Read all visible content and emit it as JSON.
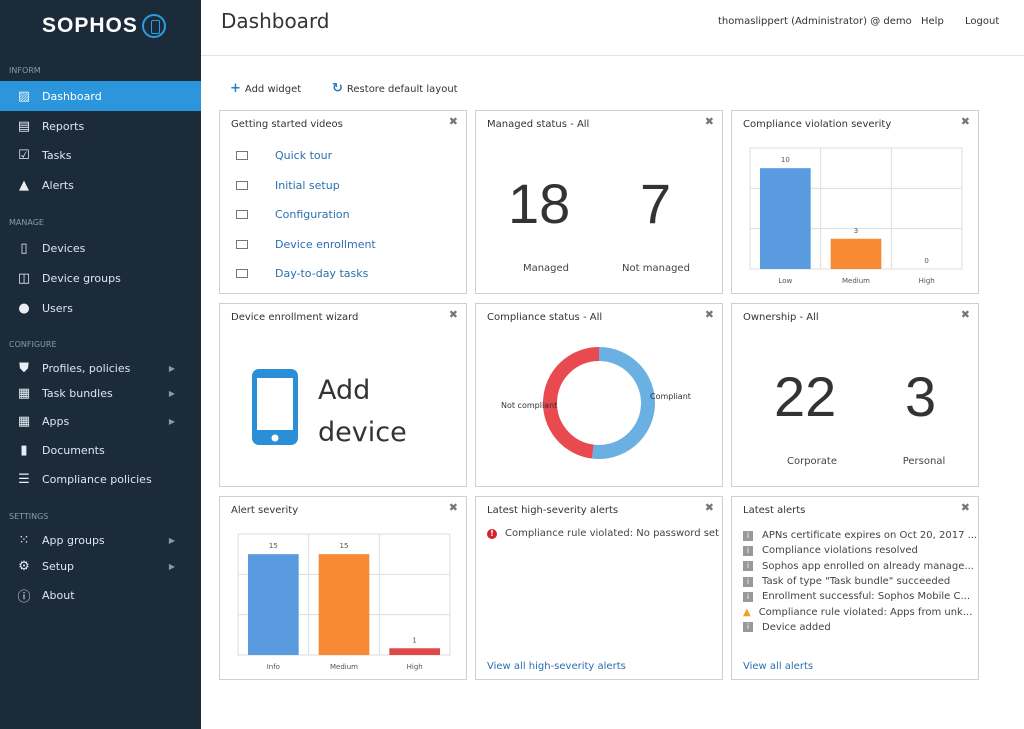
{
  "sidebar": {
    "logo": "SOPHOS",
    "sections": [
      {
        "label": "INFORM",
        "items": [
          {
            "label": "Dashboard",
            "icon": "chart-icon",
            "active": true
          },
          {
            "label": "Reports",
            "icon": "report-icon"
          },
          {
            "label": "Tasks",
            "icon": "calendar-check-icon"
          },
          {
            "label": "Alerts",
            "icon": "warning-icon"
          }
        ]
      },
      {
        "label": "MANAGE",
        "items": [
          {
            "label": "Devices",
            "icon": "phone-icon"
          },
          {
            "label": "Device groups",
            "icon": "devices-icon"
          },
          {
            "label": "Users",
            "icon": "user-icon"
          }
        ]
      },
      {
        "label": "CONFIGURE",
        "items": [
          {
            "label": "Profiles, policies",
            "icon": "shield-icon",
            "arrow": true
          },
          {
            "label": "Task bundles",
            "icon": "bundle-icon",
            "arrow": true
          },
          {
            "label": "Apps",
            "icon": "apps-icon",
            "arrow": true
          },
          {
            "label": "Documents",
            "icon": "document-icon"
          },
          {
            "label": "Compliance policies",
            "icon": "list-icon"
          }
        ]
      },
      {
        "label": "SETTINGS",
        "items": [
          {
            "label": "App groups",
            "icon": "grid-icon",
            "arrow": true
          },
          {
            "label": "Setup",
            "icon": "gear-icon",
            "arrow": true
          },
          {
            "label": "About",
            "icon": "info-icon"
          }
        ]
      }
    ]
  },
  "header": {
    "title": "Dashboard",
    "user": "thomaslippert (Administrator) @ demo",
    "help": "Help",
    "logout": "Logout"
  },
  "toolbar": {
    "add_widget": "Add widget",
    "restore": "Restore default layout"
  },
  "widgets": {
    "videos": {
      "title": "Getting started videos",
      "items": [
        "Quick tour",
        "Initial setup",
        "Configuration",
        "Device enrollment",
        "Day-to-day tasks"
      ]
    },
    "managed": {
      "title": "Managed status - All",
      "managed": "18",
      "managed_label": "Managed",
      "not_managed": "7",
      "not_managed_label": "Not managed"
    },
    "cvs": {
      "title": "Compliance violation severity"
    },
    "wizard": {
      "title": "Device enrollment wizard",
      "line1": "Add",
      "line2": "device"
    },
    "compliance": {
      "title": "Compliance status - All",
      "not_compliant": "Not compliant",
      "compliant": "Compliant"
    },
    "ownership": {
      "title": "Ownership - All",
      "corporate": "22",
      "corporate_label": "Corporate",
      "personal": "3",
      "personal_label": "Personal"
    },
    "alert_severity": {
      "title": "Alert severity"
    },
    "high_alerts": {
      "title": "Latest high-severity alerts",
      "items": [
        "Compliance rule violated: No password set"
      ],
      "link": "View all high-severity alerts"
    },
    "latest": {
      "title": "Latest alerts",
      "items": [
        {
          "text": "APNs certificate expires on Oct 20, 2017 ...",
          "type": "info"
        },
        {
          "text": "Compliance violations resolved",
          "type": "info"
        },
        {
          "text": "Sophos app enrolled on already manage...",
          "type": "info"
        },
        {
          "text": "Task of type \"Task bundle\" succeeded",
          "type": "info"
        },
        {
          "text": "Enrollment successful: Sophos Mobile C...",
          "type": "info"
        },
        {
          "text": "Compliance rule violated: Apps from unk...",
          "type": "warning"
        },
        {
          "text": "Device added",
          "type": "info"
        }
      ],
      "link": "View all alerts"
    }
  },
  "chart_data": [
    {
      "type": "bar",
      "title": "Compliance violation severity",
      "categories": [
        "Low",
        "Medium",
        "High"
      ],
      "values": [
        10,
        3,
        0
      ],
      "colors": [
        "#5a9be0",
        "#f98a35",
        "#e04848"
      ],
      "ylim": [
        0,
        12
      ],
      "grid": true
    },
    {
      "type": "pie",
      "title": "Compliance status - All",
      "donut": true,
      "slices": [
        {
          "label": "Compliant",
          "value": 52,
          "color": "#6ab0e2"
        },
        {
          "label": "Not compliant",
          "value": 48,
          "color": "#e84a50"
        }
      ]
    },
    {
      "type": "bar",
      "title": "Alert severity",
      "categories": [
        "Info",
        "Medium",
        "High"
      ],
      "values": [
        15,
        15,
        1
      ],
      "colors": [
        "#5a9be0",
        "#f98a35",
        "#e04848"
      ],
      "ylim": [
        0,
        18
      ],
      "grid": true
    }
  ]
}
